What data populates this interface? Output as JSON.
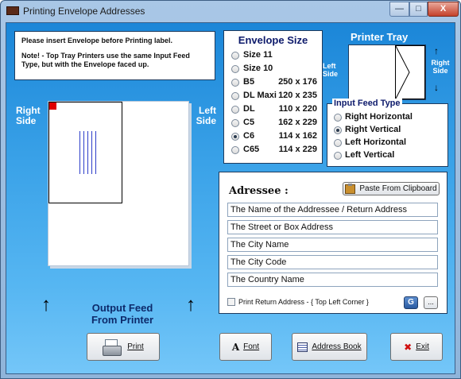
{
  "window": {
    "title": "Printing Envelope Addresses",
    "min_glyph": "—",
    "max_glyph": "□",
    "close_glyph": "X"
  },
  "note": {
    "line1": "Please insert Envelope before Printing label.",
    "line2": "Note!  -  Top Tray Printers use the same Input Feed Type, but  with the Envelope faced up."
  },
  "preview": {
    "right_side": "Right Side",
    "left_side": "Left Side",
    "output_feed": "Output Feed From Printer",
    "arrow_glyph": "↑"
  },
  "envelope_size": {
    "title": "Envelope Size",
    "options": [
      {
        "label": "Size 11",
        "dims": "",
        "selected": false
      },
      {
        "label": "Size 10",
        "dims": "",
        "selected": false
      },
      {
        "label": "B5",
        "dims": "250 x 176",
        "selected": false
      },
      {
        "label": "DL Maxi",
        "dims": "120 x 235",
        "selected": false
      },
      {
        "label": "DL",
        "dims": "110 x 220",
        "selected": false
      },
      {
        "label": "C5",
        "dims": "162 x 229",
        "selected": false
      },
      {
        "label": "C6",
        "dims": "114 x 162",
        "selected": true
      },
      {
        "label": "C65",
        "dims": "114 x 229",
        "selected": false
      }
    ]
  },
  "printer_tray": {
    "title": "Printer Tray",
    "left_side": "Left Side",
    "right_side": "Right Side",
    "up_glyph": "↑",
    "down_glyph": "↓"
  },
  "input_feed": {
    "title": "Input Feed Type",
    "options": [
      {
        "label": "Right Horizontal",
        "selected": false
      },
      {
        "label": "Right Vertical",
        "selected": true
      },
      {
        "label": "Left Horizontal",
        "selected": false
      },
      {
        "label": "Left Vertical",
        "selected": false
      }
    ]
  },
  "addressee": {
    "title": "Adressee :",
    "paste_button": "Paste From Clipboard",
    "fields": [
      "The Name of the Addressee / Return Address",
      "The Street or Box Address",
      "The City Name",
      "The City Code",
      "The Country Name"
    ],
    "return_checkbox": "Print Return Address - { Top Left Corner }",
    "return_checked": false,
    "g_button": "G",
    "more_button": "..."
  },
  "buttons": {
    "print": "Print",
    "font": "Font",
    "font_icon": "A",
    "address_book": "Address Book",
    "exit": "Exit",
    "exit_icon": "✖"
  },
  "colors": {
    "accent": "#0d1a6b",
    "envelope_marker": "#e00000",
    "address_lines": "#2c3cc9"
  }
}
